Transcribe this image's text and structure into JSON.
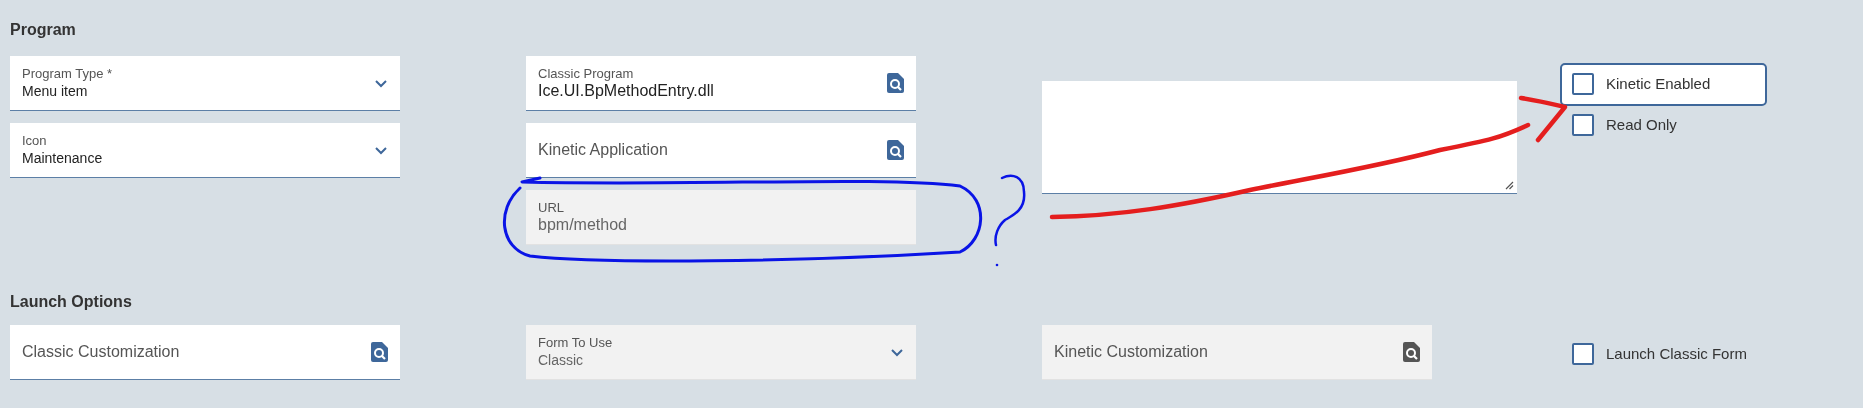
{
  "sections": [
    {
      "title": "Program",
      "columns": [
        {
          "items": [
            {
              "kind": "select",
              "label": "Program Type *",
              "value": "Menu item",
              "disabled": false
            },
            {
              "kind": "select",
              "label": "Icon",
              "value": "Maintenance",
              "disabled": false
            }
          ]
        },
        {
          "items": [
            {
              "kind": "lookup",
              "label": "Classic Program",
              "value": "Ice.UI.BpMethodEntry.dll",
              "disabled": false
            },
            {
              "kind": "lookup",
              "label": "Kinetic Application",
              "disabled": false
            },
            {
              "kind": "text",
              "label": "URL",
              "value": "bpm/method",
              "disabled": true
            }
          ]
        },
        {
          "items": [
            {
              "kind": "textarea",
              "disabled": false
            }
          ]
        },
        {
          "items": [
            {
              "kind": "checkbox",
              "label": "Kinetic Enabled",
              "checked": false,
              "focused": true
            },
            {
              "kind": "checkbox",
              "label": "Read Only",
              "checked": false,
              "focused": false
            }
          ]
        }
      ]
    },
    {
      "title": "Launch Options",
      "columns": [
        {
          "items": [
            {
              "kind": "lookup",
              "label": "Classic Customization",
              "disabled": false
            }
          ]
        },
        {
          "items": [
            {
              "kind": "select",
              "label": "Form To Use",
              "value": "Classic",
              "disabled": true
            }
          ]
        },
        {
          "items": [
            {
              "kind": "lookup",
              "label": "Kinetic Customization",
              "disabled": true
            }
          ]
        },
        {
          "items": [
            {
              "kind": "checkbox",
              "label": "Launch Classic Form",
              "checked": false,
              "focused": false
            }
          ]
        }
      ]
    }
  ],
  "annotations": [
    {
      "kind": "circle",
      "color": "#0a14e6"
    },
    {
      "kind": "question_mark",
      "color": "#0a14e6"
    },
    {
      "kind": "arrow",
      "color": "#e41e1e"
    }
  ]
}
